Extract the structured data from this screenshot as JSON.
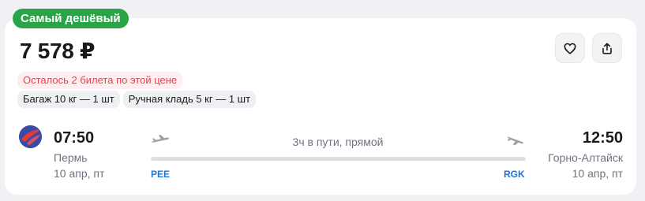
{
  "badge": "Самый дешёвый",
  "price": "7 578 ₽",
  "seats_warning": "Осталось 2 билета по этой цене",
  "baggage": [
    "Багаж 10 кг — 1 шт",
    "Ручная кладь 5 кг — 1 шт"
  ],
  "actions": {
    "favorite_icon": "heart-icon",
    "share_icon": "share-icon"
  },
  "flight": {
    "airline_logo": "airline-logo",
    "departure": {
      "time": "07:50",
      "city": "Пермь",
      "date": "10 апр, пт",
      "iata": "PEE"
    },
    "arrival": {
      "time": "12:50",
      "city": "Горно-Алтайск",
      "date": "10 апр, пт",
      "iata": "RGK"
    },
    "duration": "3ч в пути, прямой"
  },
  "colors": {
    "badge": "#29a547",
    "warning_text": "#e5424d",
    "warning_bg": "#ffeef0",
    "iata": "#1e74d6",
    "airline": "#3c4aa6"
  }
}
